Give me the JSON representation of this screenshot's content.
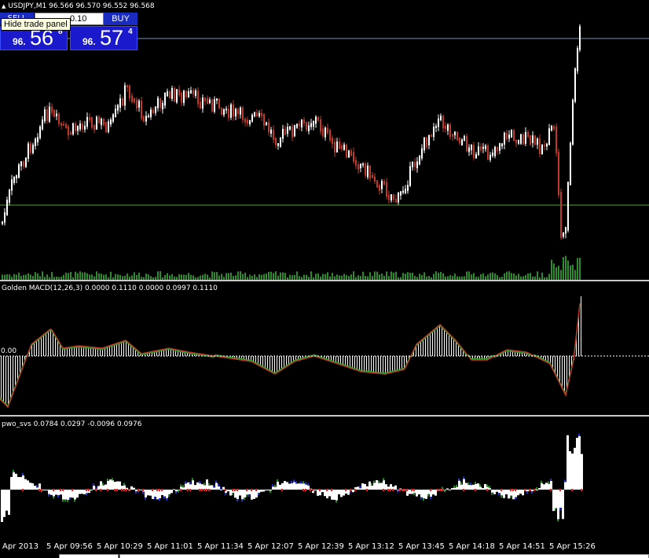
{
  "main_chart": {
    "title": "USDJPY,M1  96.566 96.570 96.552 96.568",
    "colors": {
      "bull": "#ffffff",
      "bear": "#c0392b",
      "volume": "#2e8b2e",
      "bid_line": "#7a8fb0",
      "grid_line": "#5aa02c"
    }
  },
  "trade_panel": {
    "sell_label": "SELL",
    "lot_value": "0.10",
    "buy_label": "BUY",
    "sell_price": {
      "prefix": "96.",
      "big": "56",
      "sup": "8"
    },
    "buy_price": {
      "prefix": "96.",
      "big": "57",
      "sup": "4"
    },
    "tooltip": "Hide trade panel"
  },
  "macd_panel": {
    "title": "Golden MACD(12,26,3) 0.0000 0.1110 0.0000 0.0997 0.1110",
    "level_label": "0.00"
  },
  "pwo_panel": {
    "title": "pwo_svs 0.0784 0.0297 -0.0096 0.0976"
  },
  "time_axis": {
    "ticks": [
      "Apr 2013",
      "5 Apr 09:56",
      "5 Apr 10:29",
      "5 Apr 11:01",
      "5 Apr 11:34",
      "5 Apr 12:07",
      "5 Apr 12:39",
      "5 Apr 13:12",
      "5 Apr 13:45",
      "5 Apr 14:18",
      "5 Apr 14:51",
      "5 Apr 15:26"
    ]
  }
}
